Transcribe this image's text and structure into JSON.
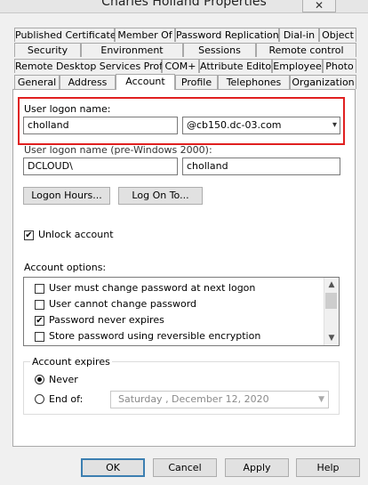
{
  "window": {
    "title": "Charles Holland Properties",
    "close_label": "✕"
  },
  "tabs": {
    "row1": [
      "Published Certificates",
      "Member Of",
      "Password Replication",
      "Dial-in",
      "Object"
    ],
    "row2": [
      "Security",
      "Environment",
      "Sessions",
      "Remote control"
    ],
    "row3": [
      "Remote Desktop Services Profile",
      "COM+",
      "Attribute Editor",
      "Employee",
      "Photo"
    ],
    "row4": [
      "General",
      "Address",
      "Account",
      "Profile",
      "Telephones",
      "Organization"
    ],
    "active": "Account"
  },
  "account": {
    "logon_label": "User logon name:",
    "logon_value": "cholland",
    "domain_value": "@cb150.dc-03.com",
    "pre2000_label": "User logon name (pre-Windows 2000):",
    "pre2000_domain": "DCLOUD\\",
    "pre2000_user": "cholland",
    "logon_hours_label": "Logon Hours...",
    "log_on_to_label": "Log On To...",
    "unlock_label": "Unlock account",
    "unlock_checked": true,
    "options_label": "Account options:",
    "options": [
      {
        "label": "User must change password at next logon",
        "checked": false
      },
      {
        "label": "User cannot change password",
        "checked": false
      },
      {
        "label": "Password never expires",
        "checked": true
      },
      {
        "label": "Store password using reversible encryption",
        "checked": false
      }
    ],
    "expires_label": "Account expires",
    "never_label": "Never",
    "endof_label": "End of:",
    "date_value": "Saturday   ,  December 12, 2020"
  },
  "footer": {
    "ok": "OK",
    "cancel": "Cancel",
    "apply": "Apply",
    "help": "Help"
  },
  "icons": {
    "check": "✔",
    "dropdown": "▾",
    "scroll_up": "▲",
    "scroll_down": "▼"
  }
}
